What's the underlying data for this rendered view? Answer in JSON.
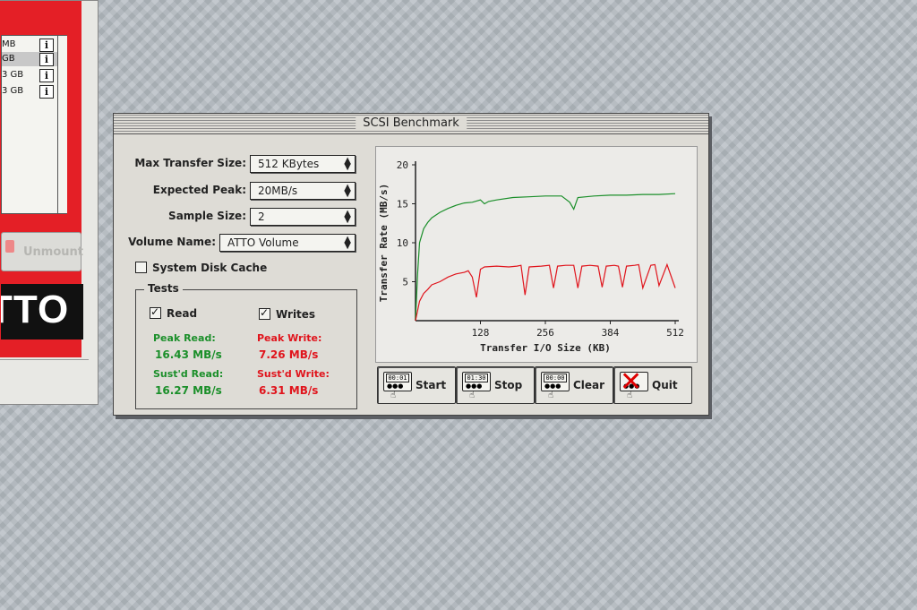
{
  "bg_window": {
    "volumes": [
      {
        "size": "MB"
      },
      {
        "size": "GB"
      },
      {
        "size": "3 GB"
      },
      {
        "size": "3 GB"
      }
    ],
    "unmount_label": "Unmount",
    "logo_text": "TTO"
  },
  "window": {
    "title": "SCSI Benchmark",
    "settings": {
      "max_transfer_label": "Max Transfer Size:",
      "max_transfer_value": "512 KBytes",
      "expected_peak_label": "Expected Peak:",
      "expected_peak_value": "20MB/s",
      "sample_size_label": "Sample Size:",
      "sample_size_value": "2",
      "volume_name_label": "Volume Name:",
      "volume_name_value": "ATTO Volume",
      "system_disk_cache_label": "System Disk Cache",
      "system_disk_cache_checked": false
    },
    "tests": {
      "title": "Tests",
      "read_label": "Read",
      "read_checked": true,
      "writes_label": "Writes",
      "writes_checked": true,
      "peak_read_label": "Peak Read:",
      "peak_read_value": "16.43 MB/s",
      "sustd_read_label": "Sust'd Read:",
      "sustd_read_value": "16.27 MB/s",
      "peak_write_label": "Peak Write:",
      "peak_write_value": "7.26 MB/s",
      "sustd_write_label": "Sust'd Write:",
      "sustd_write_value": "6.31 MB/s"
    },
    "buttons": {
      "start": {
        "label": "Start",
        "display": "00:01"
      },
      "stop": {
        "label": "Stop",
        "display": "01:30"
      },
      "clear": {
        "label": "Clear",
        "display": "00:00"
      },
      "quit": {
        "label": "Quit"
      }
    },
    "colors": {
      "read": "#1b8f2a",
      "write": "#e0141c"
    }
  },
  "chart_data": {
    "type": "line",
    "xlabel": "Transfer I/O Size (KB)",
    "ylabel": "Transfer Rate (MB/s)",
    "xlim": [
      0,
      512
    ],
    "ylim": [
      0,
      20
    ],
    "xticks": [
      128,
      256,
      384,
      512
    ],
    "xtick_labels": [
      "128",
      "256",
      "384",
      "512"
    ],
    "yticks": [
      5,
      10,
      15,
      20
    ],
    "series": [
      {
        "color": "#1b8f2a",
        "x": [
          0,
          4,
          8,
          16,
          24,
          32,
          48,
          64,
          80,
          96,
          112,
          128,
          136,
          144,
          160,
          192,
          224,
          256,
          288,
          304,
          312,
          320,
          352,
          384,
          416,
          448,
          480,
          512
        ],
        "y": [
          0,
          6,
          10,
          11.8,
          12.6,
          13.2,
          13.9,
          14.4,
          14.8,
          15.1,
          15.2,
          15.5,
          15.0,
          15.3,
          15.5,
          15.8,
          15.9,
          16.0,
          16.0,
          15.2,
          14.3,
          15.8,
          16.0,
          16.1,
          16.1,
          16.2,
          16.2,
          16.3
        ]
      },
      {
        "color": "#e0141c",
        "x": [
          0,
          8,
          16,
          24,
          32,
          48,
          64,
          80,
          96,
          104,
          112,
          120,
          128,
          136,
          160,
          184,
          200,
          208,
          216,
          224,
          248,
          264,
          272,
          280,
          296,
          312,
          320,
          328,
          344,
          360,
          368,
          376,
          392,
          400,
          408,
          416,
          432,
          440,
          448,
          464,
          472,
          480,
          496,
          512
        ],
        "y": [
          0,
          2.5,
          3.5,
          4.0,
          4.6,
          5.0,
          5.6,
          6.0,
          6.2,
          6.4,
          5.6,
          3.0,
          6.6,
          6.9,
          7.0,
          6.9,
          7.0,
          7.1,
          3.3,
          6.9,
          7.0,
          7.1,
          4.2,
          7.0,
          7.1,
          7.1,
          4.2,
          7.0,
          7.1,
          7.0,
          4.3,
          7.0,
          7.1,
          7.0,
          4.3,
          7.0,
          7.1,
          7.2,
          4.2,
          7.1,
          7.2,
          4.5,
          7.2,
          4.2
        ]
      }
    ],
    "grid": false,
    "legend": "none"
  }
}
